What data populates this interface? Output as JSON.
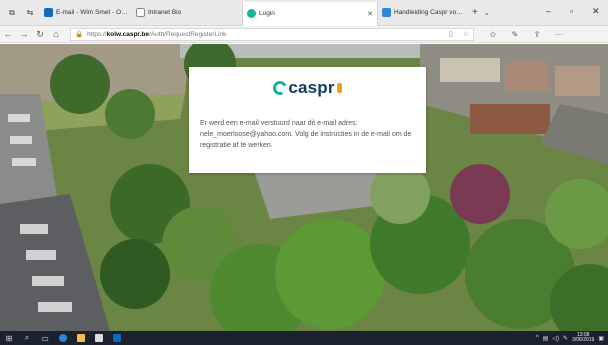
{
  "browser": {
    "tabs": [
      {
        "label": "E-mail - Wim Smet - Outloo",
        "icon": "outlook-mail-icon",
        "color": "#0f6cbd",
        "active": false
      },
      {
        "label": "Intranet Bio",
        "icon": "page-icon",
        "color": "#888888",
        "active": false
      },
      {
        "label": "Login",
        "icon": "caspr-favicon-icon",
        "color": "#17b49b",
        "active": true
      },
      {
        "label": "Handleiding Caspr voor bel",
        "icon": "edge-page-icon",
        "color": "#2b88d8",
        "active": false
      }
    ],
    "url": {
      "scheme": "https://",
      "host": "kolw.caspr.be",
      "path": "/Auth/RequestRegisterLink"
    }
  },
  "card": {
    "logo_text": "caspr",
    "message": "Er werd een e-mail verstuurd naar dit e-mail adres: nele_moerloose@yahoo.com. Volg de instructies in de e-mail om de registratie af te werken."
  },
  "taskbar": {
    "time": "13:08",
    "date": "3/06/2019"
  },
  "colors": {
    "brand_teal": "#17b49b",
    "brand_navy": "#143c63",
    "brand_orange": "#f59f18",
    "taskbar_bg": "#1c2130"
  }
}
